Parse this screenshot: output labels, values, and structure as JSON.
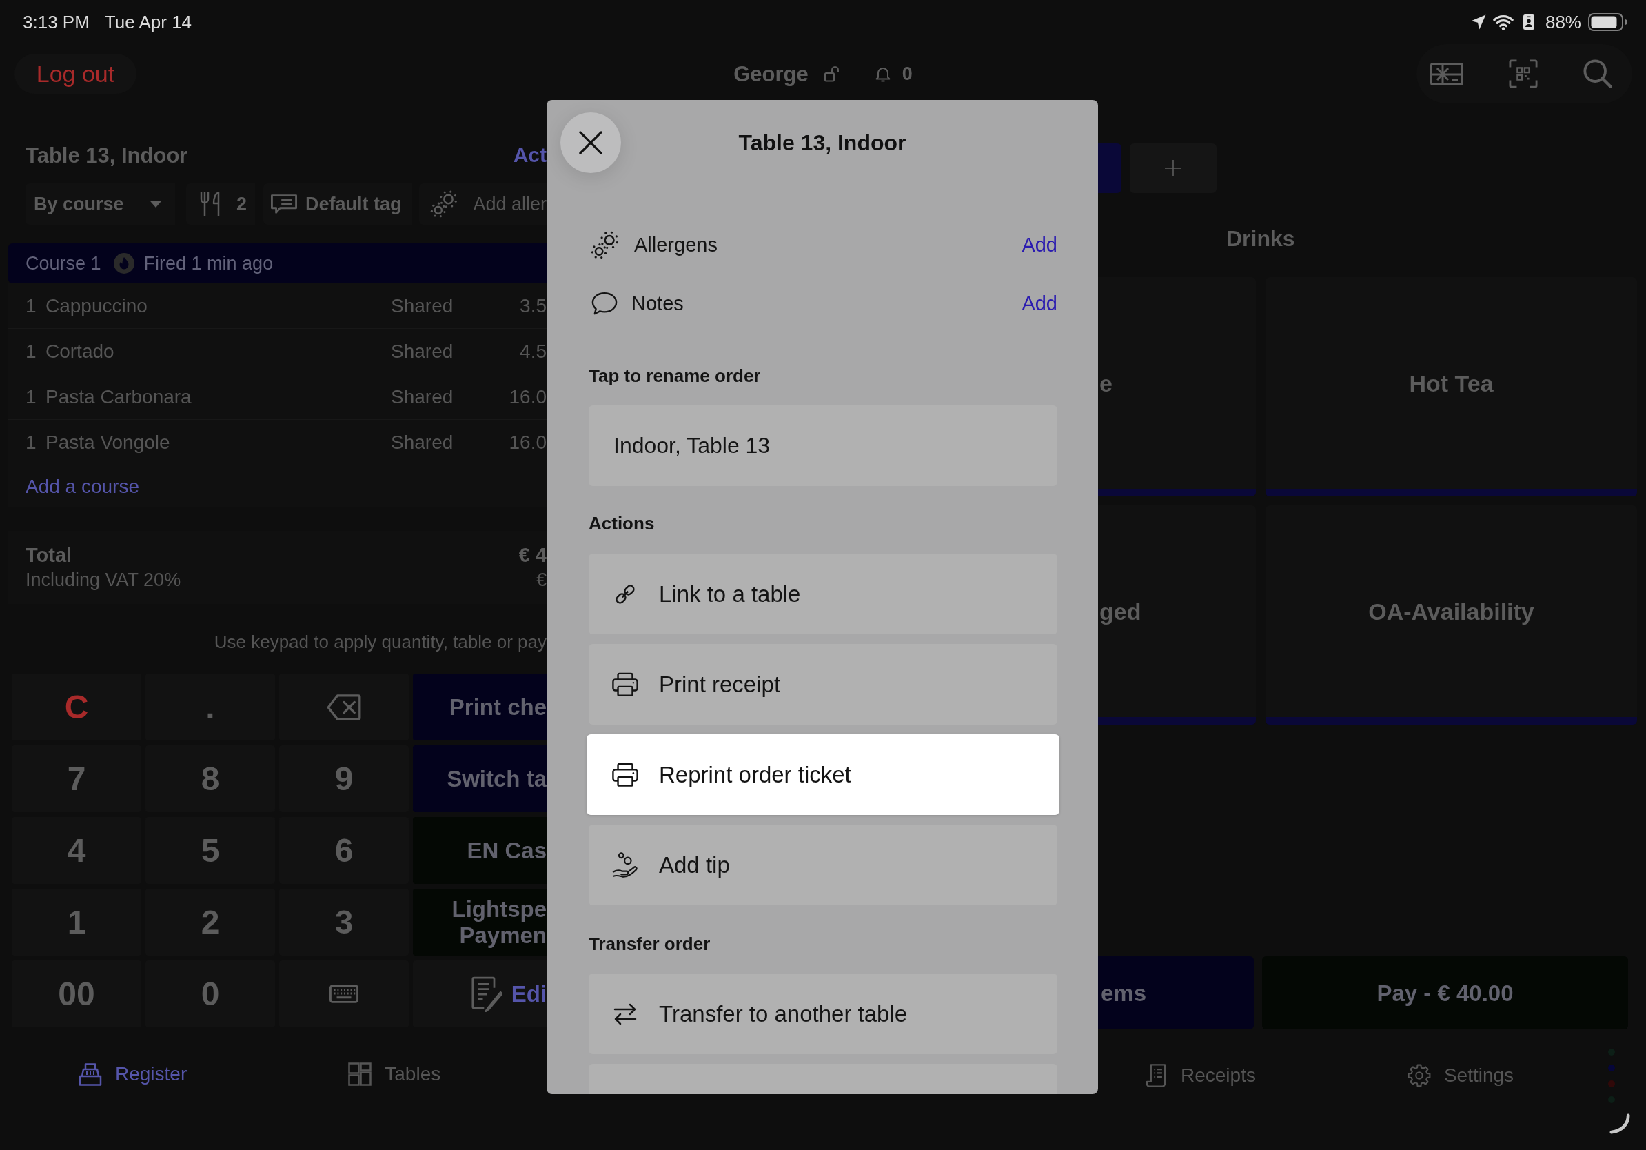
{
  "status_bar": {
    "time": "3:13 PM",
    "date": "Tue Apr 14",
    "battery": "88%"
  },
  "top_bar": {
    "logout": "Log out",
    "user": "George",
    "notifications": "0"
  },
  "order": {
    "title": "Table 13, Indoor",
    "actions_link": "Act",
    "toolbar": [
      {
        "kind": "dropdown",
        "label": "By course"
      },
      {
        "kind": "guests",
        "label": "2"
      },
      {
        "kind": "tag",
        "label": "Default tag"
      },
      {
        "kind": "allergens",
        "label": "Add aller"
      }
    ],
    "course": {
      "name": "Course 1",
      "status": "Fired 1 min ago"
    },
    "items": [
      {
        "quantity": "1",
        "name": "Cappuccino",
        "seat": "Shared",
        "price": "3.5"
      },
      {
        "quantity": "1",
        "name": "Cortado",
        "seat": "Shared",
        "price": "4.5"
      },
      {
        "quantity": "1",
        "name": "Pasta Carbonara",
        "seat": "Shared",
        "price": "16.0"
      },
      {
        "quantity": "1",
        "name": "Pasta Vongole",
        "seat": "Shared",
        "price": "16.0"
      }
    ],
    "add_course": "Add a course",
    "total": {
      "label": "Total",
      "amount": "€ 4",
      "vat_label": "Including VAT 20%",
      "vat_amount": "€"
    }
  },
  "keypad": {
    "hint": "Use keypad to apply quantity, table or pay",
    "keys": [
      {
        "kind": "clear",
        "label": "C"
      },
      {
        "kind": "digit",
        "label": "."
      },
      {
        "kind": "backspace"
      },
      {
        "kind": "digit",
        "label": "7"
      },
      {
        "kind": "digit",
        "label": "8"
      },
      {
        "kind": "digit",
        "label": "9"
      },
      {
        "kind": "digit",
        "label": "4"
      },
      {
        "kind": "digit",
        "label": "5"
      },
      {
        "kind": "digit",
        "label": "6"
      },
      {
        "kind": "digit",
        "label": "1"
      },
      {
        "kind": "digit",
        "label": "2"
      },
      {
        "kind": "digit",
        "label": "3"
      },
      {
        "kind": "digit",
        "label": "00"
      },
      {
        "kind": "digit",
        "label": "0"
      },
      {
        "kind": "keyboard"
      }
    ],
    "actions": [
      {
        "kind": "action",
        "lines": [
          "Print che"
        ],
        "color": "#03021c"
      },
      {
        "kind": "action",
        "lines": [
          "Switch ta"
        ],
        "color": "#03021c"
      },
      {
        "kind": "action",
        "lines": [
          "EN Cas"
        ],
        "color": "#040804"
      },
      {
        "kind": "action",
        "lines": [
          "Lightspe",
          "Paymen"
        ],
        "color": "#040804"
      },
      {
        "kind": "edit",
        "lines": [
          "Edi"
        ]
      }
    ]
  },
  "order_nav": [
    {
      "kind": "register",
      "label": "Register",
      "selected": true
    },
    {
      "kind": "tables",
      "label": "Tables",
      "selected": false
    }
  ],
  "menu": {
    "tabs": [
      {
        "kind": "category",
        "selected": true
      },
      {
        "kind": "add",
        "selected": false
      }
    ],
    "section": "Drinks",
    "tiles": [
      {
        "label": "e"
      },
      {
        "label": "Hot Tea"
      },
      {
        "label": "ged"
      },
      {
        "label": "OA-Availability"
      }
    ],
    "buttons": [
      {
        "label": "ems",
        "color": "#03021c"
      },
      {
        "label": "Pay - € 40.00",
        "color": "#040804"
      }
    ],
    "nav": [
      {
        "kind": "receipts",
        "label": "Receipts",
        "selected": false
      },
      {
        "kind": "settings",
        "label": "Settings",
        "selected": false
      }
    ],
    "page_dots": [
      {
        "color": "#0d1f17"
      },
      {
        "color": "#06063a"
      },
      {
        "color": "#300909"
      },
      {
        "color": "#0d1f17"
      }
    ]
  },
  "dialog": {
    "title": "Table 13, Indoor",
    "options": [
      {
        "kind": "allergens",
        "label": "Allergens",
        "action": "Add"
      },
      {
        "kind": "notes",
        "label": "Notes",
        "action": "Add"
      }
    ],
    "rename": {
      "label": "Tap to rename order",
      "value": "Indoor, Table 13"
    },
    "sections": [
      {
        "title": "Actions",
        "items": [
          {
            "kind": "link",
            "label": "Link to a table",
            "selected": false
          },
          {
            "kind": "printer",
            "label": "Print receipt",
            "selected": false
          },
          {
            "kind": "printer",
            "label": "Reprint order ticket",
            "selected": true
          },
          {
            "kind": "tip",
            "label": "Add tip",
            "selected": false
          }
        ]
      },
      {
        "title": "Transfer order",
        "items": [
          {
            "kind": "transfer",
            "label": "Transfer to another table",
            "selected": false
          },
          {
            "kind": "blank",
            "selected": false
          }
        ]
      }
    ]
  }
}
